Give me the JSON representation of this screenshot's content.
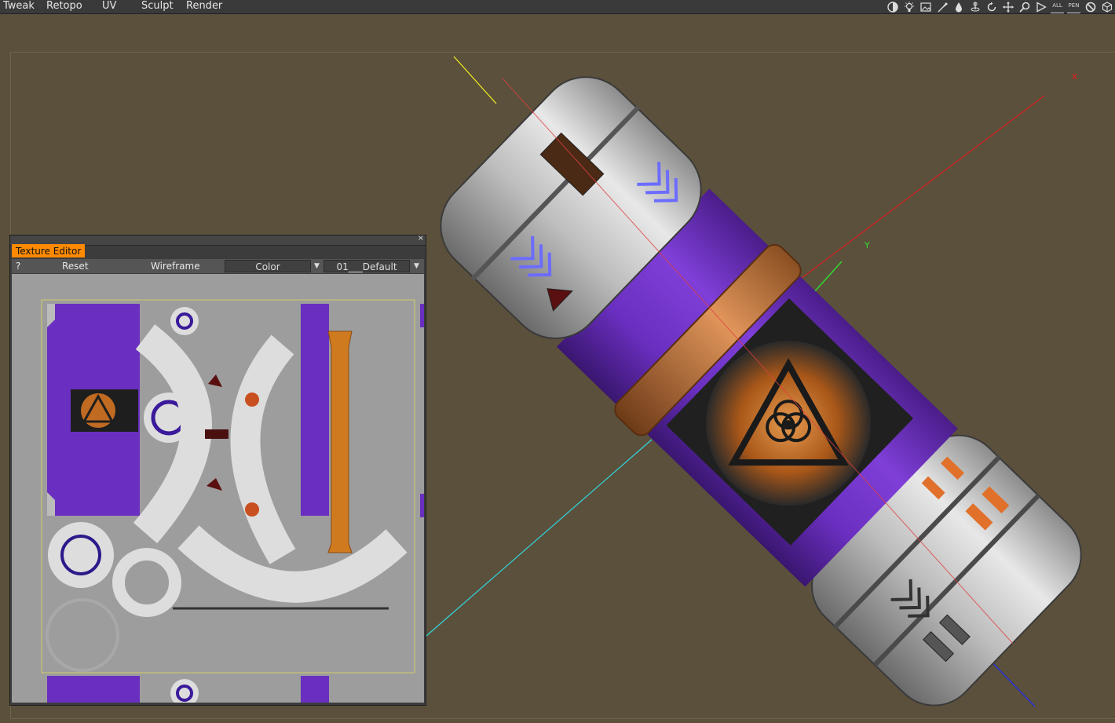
{
  "menu": {
    "items": [
      "Tweak",
      "Retopo",
      "UV",
      "Sculpt",
      "Render"
    ]
  },
  "toolbar_icons": [
    "contrast-icon",
    "light-icon",
    "image-icon",
    "paint-icon",
    "drop-icon",
    "rotate-pivot-icon",
    "rotate-icon",
    "move-icon",
    "search-icon",
    "play-icon",
    "all-icon",
    "pen-icon",
    "no-icon",
    "cube-icon"
  ],
  "toolbar_labels": {
    "all": "ALL",
    "pen": "PEN"
  },
  "viewport": {
    "axis_label_x": "x",
    "axis_label_y": "Y",
    "colors": {
      "background": "#5b503c",
      "axis_x": "#e02020",
      "axis_y": "#30e030",
      "axis_z": "#2030e0",
      "accent_orange": "#ff8a00",
      "capsule_purple": "#6a2fc0"
    }
  },
  "texture_editor": {
    "tab_label": "Texture  Editor",
    "help_label": "?",
    "reset_label": "Reset",
    "wireframe_label": "Wireframe",
    "channel_select": "Color",
    "material_select": "01___Default",
    "close_glyph": "×"
  }
}
